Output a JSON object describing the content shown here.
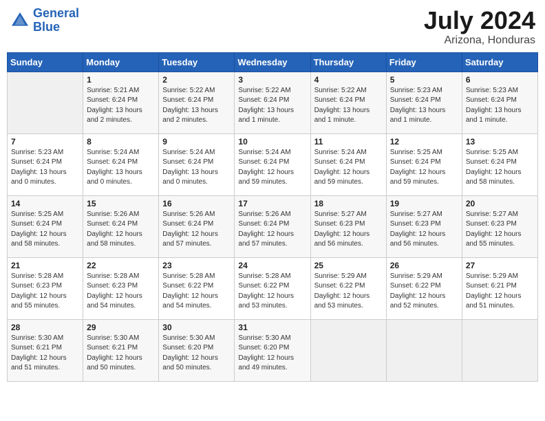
{
  "header": {
    "logo_line1": "General",
    "logo_line2": "Blue",
    "month_year": "July 2024",
    "location": "Arizona, Honduras"
  },
  "days_of_week": [
    "Sunday",
    "Monday",
    "Tuesday",
    "Wednesday",
    "Thursday",
    "Friday",
    "Saturday"
  ],
  "weeks": [
    [
      {
        "day": "",
        "info": ""
      },
      {
        "day": "1",
        "info": "Sunrise: 5:21 AM\nSunset: 6:24 PM\nDaylight: 13 hours\nand 2 minutes."
      },
      {
        "day": "2",
        "info": "Sunrise: 5:22 AM\nSunset: 6:24 PM\nDaylight: 13 hours\nand 2 minutes."
      },
      {
        "day": "3",
        "info": "Sunrise: 5:22 AM\nSunset: 6:24 PM\nDaylight: 13 hours\nand 1 minute."
      },
      {
        "day": "4",
        "info": "Sunrise: 5:22 AM\nSunset: 6:24 PM\nDaylight: 13 hours\nand 1 minute."
      },
      {
        "day": "5",
        "info": "Sunrise: 5:23 AM\nSunset: 6:24 PM\nDaylight: 13 hours\nand 1 minute."
      },
      {
        "day": "6",
        "info": "Sunrise: 5:23 AM\nSunset: 6:24 PM\nDaylight: 13 hours\nand 1 minute."
      }
    ],
    [
      {
        "day": "7",
        "info": "Sunrise: 5:23 AM\nSunset: 6:24 PM\nDaylight: 13 hours\nand 0 minutes."
      },
      {
        "day": "8",
        "info": "Sunrise: 5:24 AM\nSunset: 6:24 PM\nDaylight: 13 hours\nand 0 minutes."
      },
      {
        "day": "9",
        "info": "Sunrise: 5:24 AM\nSunset: 6:24 PM\nDaylight: 13 hours\nand 0 minutes."
      },
      {
        "day": "10",
        "info": "Sunrise: 5:24 AM\nSunset: 6:24 PM\nDaylight: 12 hours\nand 59 minutes."
      },
      {
        "day": "11",
        "info": "Sunrise: 5:24 AM\nSunset: 6:24 PM\nDaylight: 12 hours\nand 59 minutes."
      },
      {
        "day": "12",
        "info": "Sunrise: 5:25 AM\nSunset: 6:24 PM\nDaylight: 12 hours\nand 59 minutes."
      },
      {
        "day": "13",
        "info": "Sunrise: 5:25 AM\nSunset: 6:24 PM\nDaylight: 12 hours\nand 58 minutes."
      }
    ],
    [
      {
        "day": "14",
        "info": "Sunrise: 5:25 AM\nSunset: 6:24 PM\nDaylight: 12 hours\nand 58 minutes."
      },
      {
        "day": "15",
        "info": "Sunrise: 5:26 AM\nSunset: 6:24 PM\nDaylight: 12 hours\nand 58 minutes."
      },
      {
        "day": "16",
        "info": "Sunrise: 5:26 AM\nSunset: 6:24 PM\nDaylight: 12 hours\nand 57 minutes."
      },
      {
        "day": "17",
        "info": "Sunrise: 5:26 AM\nSunset: 6:24 PM\nDaylight: 12 hours\nand 57 minutes."
      },
      {
        "day": "18",
        "info": "Sunrise: 5:27 AM\nSunset: 6:23 PM\nDaylight: 12 hours\nand 56 minutes."
      },
      {
        "day": "19",
        "info": "Sunrise: 5:27 AM\nSunset: 6:23 PM\nDaylight: 12 hours\nand 56 minutes."
      },
      {
        "day": "20",
        "info": "Sunrise: 5:27 AM\nSunset: 6:23 PM\nDaylight: 12 hours\nand 55 minutes."
      }
    ],
    [
      {
        "day": "21",
        "info": "Sunrise: 5:28 AM\nSunset: 6:23 PM\nDaylight: 12 hours\nand 55 minutes."
      },
      {
        "day": "22",
        "info": "Sunrise: 5:28 AM\nSunset: 6:23 PM\nDaylight: 12 hours\nand 54 minutes."
      },
      {
        "day": "23",
        "info": "Sunrise: 5:28 AM\nSunset: 6:22 PM\nDaylight: 12 hours\nand 54 minutes."
      },
      {
        "day": "24",
        "info": "Sunrise: 5:28 AM\nSunset: 6:22 PM\nDaylight: 12 hours\nand 53 minutes."
      },
      {
        "day": "25",
        "info": "Sunrise: 5:29 AM\nSunset: 6:22 PM\nDaylight: 12 hours\nand 53 minutes."
      },
      {
        "day": "26",
        "info": "Sunrise: 5:29 AM\nSunset: 6:22 PM\nDaylight: 12 hours\nand 52 minutes."
      },
      {
        "day": "27",
        "info": "Sunrise: 5:29 AM\nSunset: 6:21 PM\nDaylight: 12 hours\nand 51 minutes."
      }
    ],
    [
      {
        "day": "28",
        "info": "Sunrise: 5:30 AM\nSunset: 6:21 PM\nDaylight: 12 hours\nand 51 minutes."
      },
      {
        "day": "29",
        "info": "Sunrise: 5:30 AM\nSunset: 6:21 PM\nDaylight: 12 hours\nand 50 minutes."
      },
      {
        "day": "30",
        "info": "Sunrise: 5:30 AM\nSunset: 6:20 PM\nDaylight: 12 hours\nand 50 minutes."
      },
      {
        "day": "31",
        "info": "Sunrise: 5:30 AM\nSunset: 6:20 PM\nDaylight: 12 hours\nand 49 minutes."
      },
      {
        "day": "",
        "info": ""
      },
      {
        "day": "",
        "info": ""
      },
      {
        "day": "",
        "info": ""
      }
    ]
  ]
}
